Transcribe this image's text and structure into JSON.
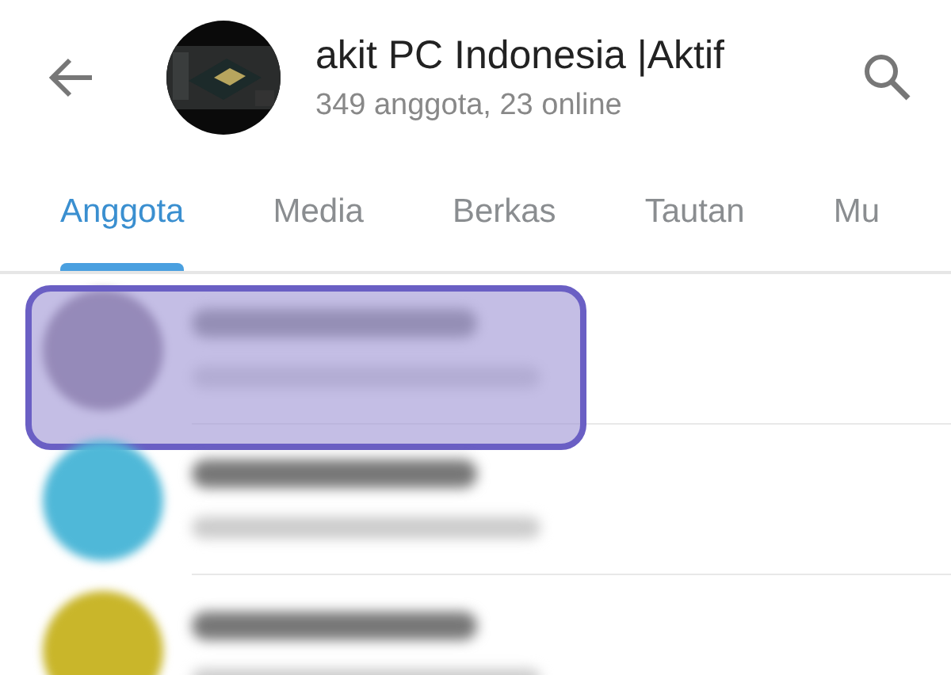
{
  "header": {
    "title": "akit PC Indonesia |Aktif",
    "subtitle": "349 anggota, 23 online"
  },
  "tabs": [
    {
      "label": "Anggota",
      "selected": true
    },
    {
      "label": "Media",
      "selected": false
    },
    {
      "label": "Berkas",
      "selected": false
    },
    {
      "label": "Tautan",
      "selected": false
    },
    {
      "label": "Mu",
      "selected": false
    }
  ],
  "members": [
    {
      "selected": true
    },
    {
      "selected": false
    },
    {
      "selected": false
    }
  ]
}
